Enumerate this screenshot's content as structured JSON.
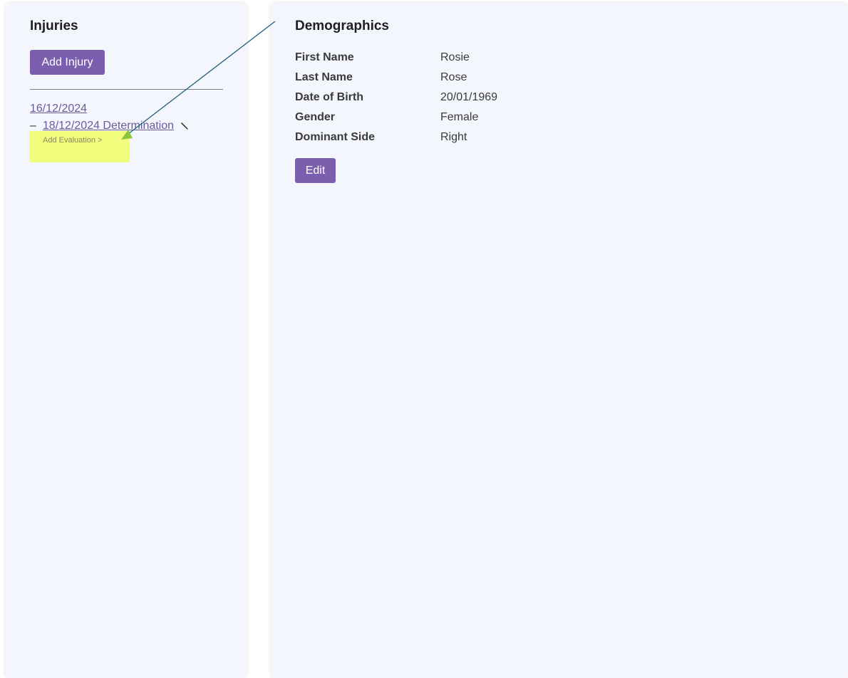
{
  "injuries": {
    "title": "Injuries",
    "add_injury_label": "Add Injury",
    "items": [
      {
        "date": "16/12/2024",
        "evaluations": [
          {
            "dash": "–",
            "label": "18/12/2024 Determination"
          }
        ],
        "add_evaluation_label": "Add Evaluation >"
      }
    ]
  },
  "demographics": {
    "title": "Demographics",
    "fields": [
      {
        "label": "First Name",
        "value": "Rosie"
      },
      {
        "label": "Last Name",
        "value": "Rose"
      },
      {
        "label": "Date of Birth",
        "value": "20/01/1969"
      },
      {
        "label": "Gender",
        "value": "Female"
      },
      {
        "label": "Dominant Side",
        "value": "Right"
      }
    ],
    "edit_label": "Edit"
  },
  "colors": {
    "accent": "#7b5fae",
    "link": "#6b5a9c",
    "panel_bg": "#f4f6fd",
    "highlight": "#f0ff50",
    "annotation_line": "#1f5f7a",
    "annotation_arrowhead": "#8cc63f"
  }
}
